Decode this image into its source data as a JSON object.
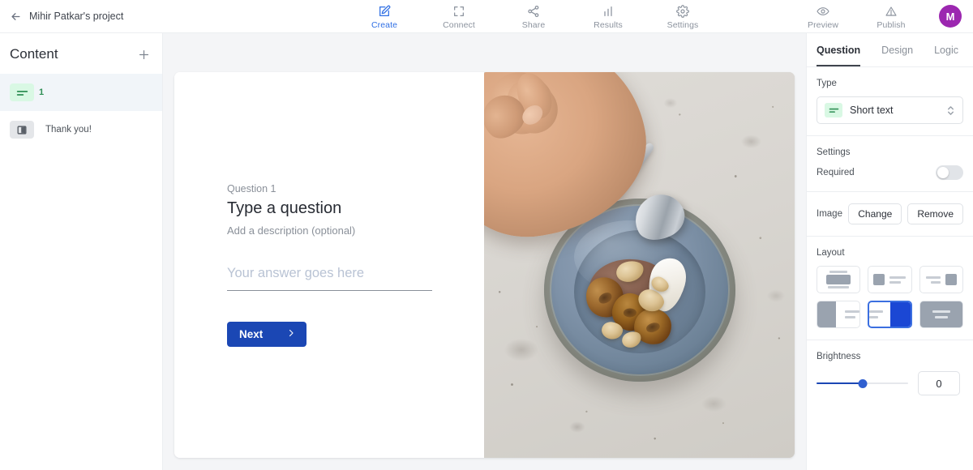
{
  "header": {
    "back_icon": "arrow-left-icon",
    "project_title": "Mihir Patkar's project",
    "nav": [
      {
        "label": "Create",
        "icon": "pencil-square-icon",
        "active": true
      },
      {
        "label": "Connect",
        "icon": "expand-arrows-icon",
        "active": false
      },
      {
        "label": "Share",
        "icon": "share-nodes-icon",
        "active": false
      },
      {
        "label": "Results",
        "icon": "bar-chart-icon",
        "active": false
      },
      {
        "label": "Settings",
        "icon": "gear-icon",
        "active": false
      }
    ],
    "preview_label": "Preview",
    "preview_icon": "eye-icon",
    "publish_label": "Publish",
    "publish_icon": "upload-triangle-icon",
    "avatar_initial": "M",
    "avatar_color": "#9c27b0",
    "accent_color": "#2f6fe4"
  },
  "sidebar": {
    "title": "Content",
    "add_icon": "plus-icon",
    "items": [
      {
        "number": "1",
        "label": "",
        "icon": "short-text-icon",
        "badge_color": "#d9f8e4",
        "selected": true
      },
      {
        "number": "",
        "label": "Thank you!",
        "icon": "ending-screen-icon",
        "badge_color": "#e4e6e9",
        "selected": false
      }
    ]
  },
  "question_card": {
    "question_index": "Question 1",
    "question_title": "Type a question",
    "question_description": "Add a description (optional)",
    "answer_value": "",
    "answer_placeholder": "Your answer goes here",
    "next_label": "Next",
    "next_icon": "chevron-right-icon",
    "next_color": "#1b47b4",
    "image_alt": "Hand holding a spoon over a blue ceramic plate with chocolate mousse, caramelized plums, walnuts and a cream quenelle on a speckled stone surface"
  },
  "right_panel": {
    "tabs": [
      {
        "label": "Question",
        "active": true
      },
      {
        "label": "Design",
        "active": false
      },
      {
        "label": "Logic",
        "active": false
      }
    ],
    "type": {
      "label": "Type",
      "value": "Short text",
      "icon": "short-text-icon",
      "chevron_icon": "chevron-up-down-icon"
    },
    "settings": {
      "label": "Settings",
      "required_label": "Required",
      "required_on": false
    },
    "image": {
      "label": "Image",
      "change_label": "Change",
      "remove_label": "Remove"
    },
    "layout": {
      "label": "Layout",
      "options": [
        {
          "name": "image-top-centered",
          "selected": false
        },
        {
          "name": "image-left-small",
          "selected": false
        },
        {
          "name": "image-right-small",
          "selected": false
        },
        {
          "name": "image-left-split",
          "selected": false
        },
        {
          "name": "image-right-split",
          "selected": true
        },
        {
          "name": "image-full-background",
          "selected": false
        }
      ],
      "selected_color": "#3b6fe0"
    },
    "brightness": {
      "label": "Brightness",
      "value": "0",
      "percent": 50,
      "min": -100,
      "max": 100,
      "accent": "#1b47b4"
    }
  }
}
